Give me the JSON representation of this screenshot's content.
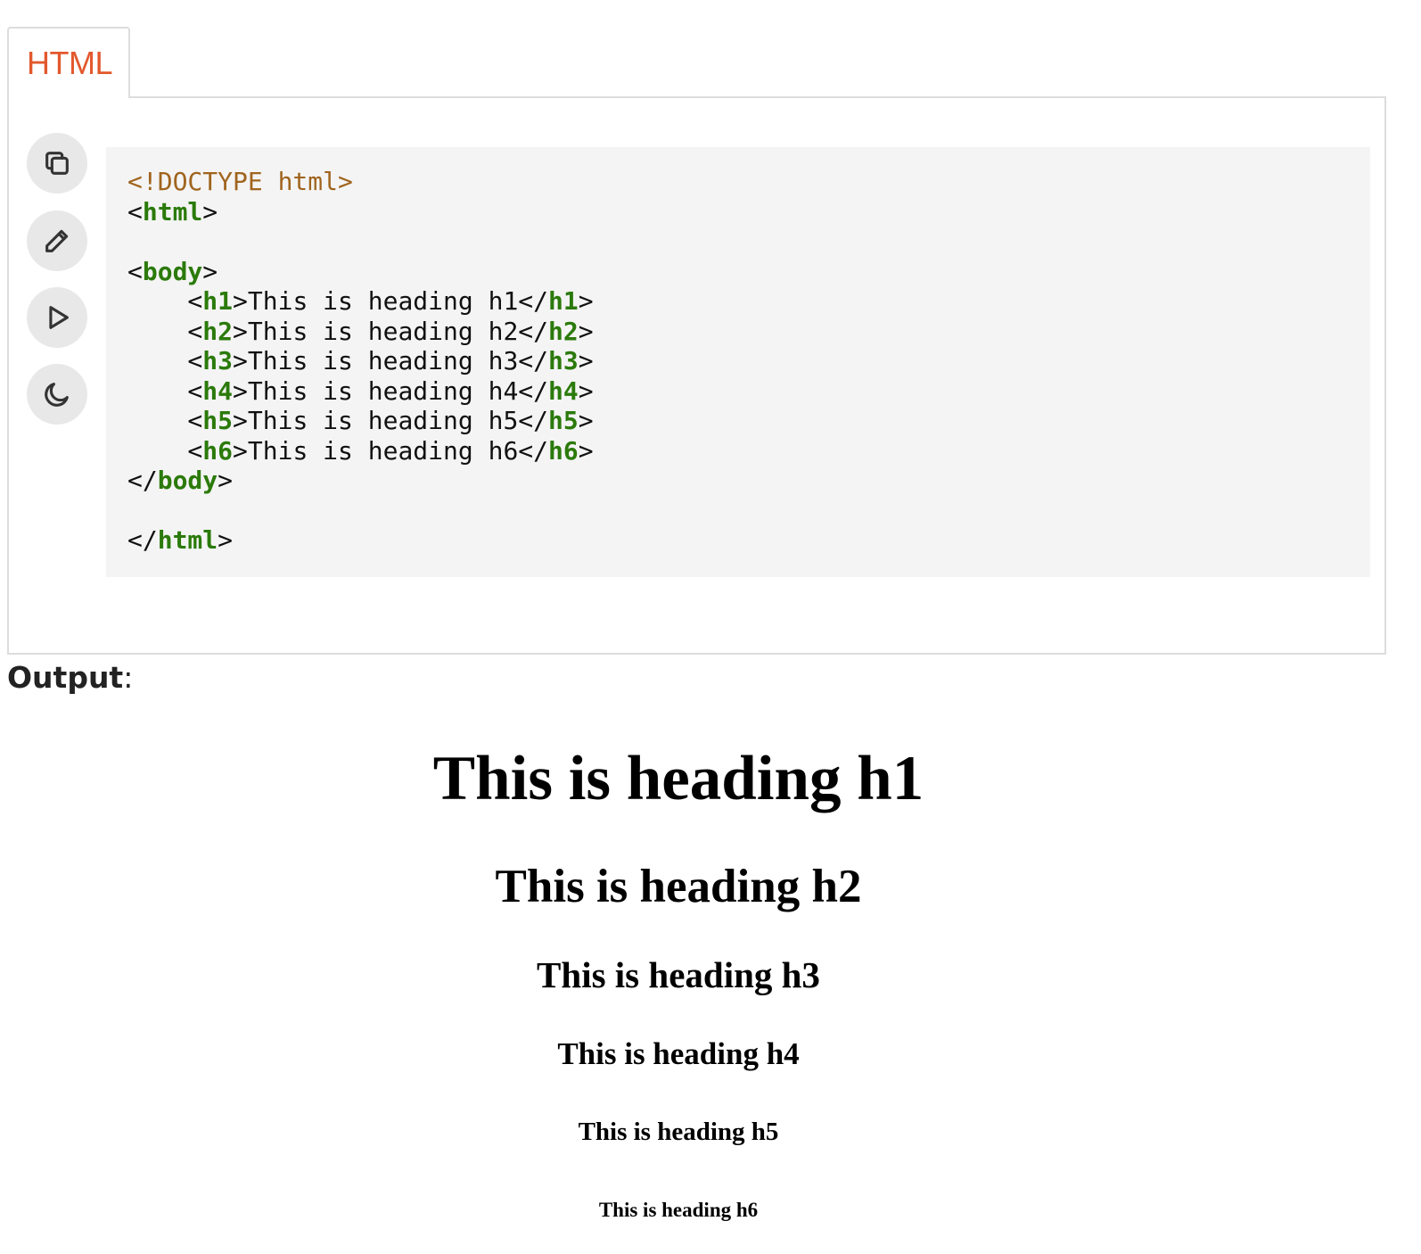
{
  "tab": {
    "label": "HTML",
    "color": "#e2582c"
  },
  "toolbar": {
    "buttons": [
      {
        "name": "copy",
        "icon": "copy-icon"
      },
      {
        "name": "edit",
        "icon": "pencil-icon"
      },
      {
        "name": "run",
        "icon": "play-icon"
      },
      {
        "name": "theme",
        "icon": "moon-icon"
      }
    ]
  },
  "code": {
    "lines": [
      [
        {
          "t": "<!DOCTYPE html>",
          "c": "doctype"
        }
      ],
      [
        {
          "t": "<"
        },
        {
          "t": "html",
          "c": "tag"
        },
        {
          "t": ">"
        }
      ],
      [],
      [
        {
          "t": "<"
        },
        {
          "t": "body",
          "c": "tag"
        },
        {
          "t": ">"
        }
      ],
      [
        {
          "t": "    <"
        },
        {
          "t": "h1",
          "c": "tag"
        },
        {
          "t": ">This is heading h1</"
        },
        {
          "t": "h1",
          "c": "tag"
        },
        {
          "t": ">"
        }
      ],
      [
        {
          "t": "    <"
        },
        {
          "t": "h2",
          "c": "tag"
        },
        {
          "t": ">This is heading h2</"
        },
        {
          "t": "h2",
          "c": "tag"
        },
        {
          "t": ">"
        }
      ],
      [
        {
          "t": "    <"
        },
        {
          "t": "h3",
          "c": "tag"
        },
        {
          "t": ">This is heading h3</"
        },
        {
          "t": "h3",
          "c": "tag"
        },
        {
          "t": ">"
        }
      ],
      [
        {
          "t": "    <"
        },
        {
          "t": "h4",
          "c": "tag"
        },
        {
          "t": ">This is heading h4</"
        },
        {
          "t": "h4",
          "c": "tag"
        },
        {
          "t": ">"
        }
      ],
      [
        {
          "t": "    <"
        },
        {
          "t": "h5",
          "c": "tag"
        },
        {
          "t": ">This is heading h5</"
        },
        {
          "t": "h5",
          "c": "tag"
        },
        {
          "t": ">"
        }
      ],
      [
        {
          "t": "    <"
        },
        {
          "t": "h6",
          "c": "tag"
        },
        {
          "t": ">This is heading h6</"
        },
        {
          "t": "h6",
          "c": "tag"
        },
        {
          "t": ">"
        }
      ],
      [
        {
          "t": "</"
        },
        {
          "t": "body",
          "c": "tag"
        },
        {
          "t": ">"
        }
      ],
      [],
      [
        {
          "t": "</"
        },
        {
          "t": "html",
          "c": "tag"
        },
        {
          "t": ">"
        }
      ]
    ]
  },
  "output": {
    "label": "Output",
    "colon": ":",
    "headings": {
      "h1": "This is heading h1",
      "h2": "This is heading h2",
      "h3": "This is heading h3",
      "h4": "This is heading h4",
      "h5": "This is heading h5",
      "h6": "This is heading h6"
    }
  },
  "colors": {
    "tag": "#2b7a0b",
    "doctype": "#a0641e",
    "code_background": "#f4f4f4",
    "button_background": "#e8e8e8"
  }
}
